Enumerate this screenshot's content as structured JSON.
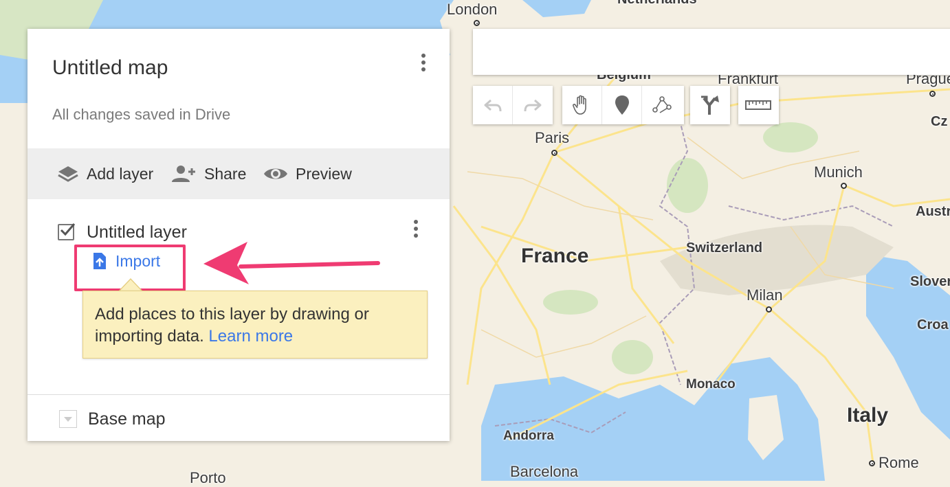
{
  "map": {
    "labels": [
      {
        "id": "london",
        "text": "London"
      },
      {
        "id": "netherlands",
        "text": "Netherlands"
      },
      {
        "id": "belgium",
        "text": "Belgium"
      },
      {
        "id": "frankfurt",
        "text": "Frankfurt"
      },
      {
        "id": "prague",
        "text": "Prague"
      },
      {
        "id": "cz",
        "text": "Cz"
      },
      {
        "id": "paris",
        "text": "Paris"
      },
      {
        "id": "munich",
        "text": "Munich"
      },
      {
        "id": "austria",
        "text": "Austria"
      },
      {
        "id": "france",
        "text": "France"
      },
      {
        "id": "switzerland",
        "text": "Switzerland"
      },
      {
        "id": "slovenia",
        "text": "Slover"
      },
      {
        "id": "milan",
        "text": "Milan"
      },
      {
        "id": "croatia",
        "text": "Croa"
      },
      {
        "id": "monaco",
        "text": "Monaco"
      },
      {
        "id": "andorra",
        "text": "Andorra"
      },
      {
        "id": "italy",
        "text": "Italy"
      },
      {
        "id": "rome",
        "text": "Rome"
      },
      {
        "id": "barcelona",
        "text": "Barcelona"
      },
      {
        "id": "porto",
        "text": "Porto"
      }
    ]
  },
  "toolbar": {
    "buttons": [
      "undo-icon",
      "redo-icon",
      "hand-icon",
      "marker-icon",
      "draw-line-icon",
      "directions-icon",
      "ruler-icon"
    ]
  },
  "panel": {
    "title": "Untitled map",
    "save_status": "All changes saved in Drive",
    "actions": {
      "add_layer": "Add layer",
      "share": "Share",
      "preview": "Preview"
    },
    "layer": {
      "name": "Untitled layer",
      "checked": true,
      "import_label": "Import"
    },
    "tooltip": {
      "text": "Add places to this layer by drawing or importing data. ",
      "link": "Learn more"
    },
    "base_map": "Base map"
  },
  "colors": {
    "accent_blue": "#3b78e7",
    "highlight_pink": "#ef3b72",
    "tooltip_bg": "#fbf0bf",
    "sea": "#a4d0f5",
    "land": "#f4efe3",
    "road": "#fce48c"
  }
}
